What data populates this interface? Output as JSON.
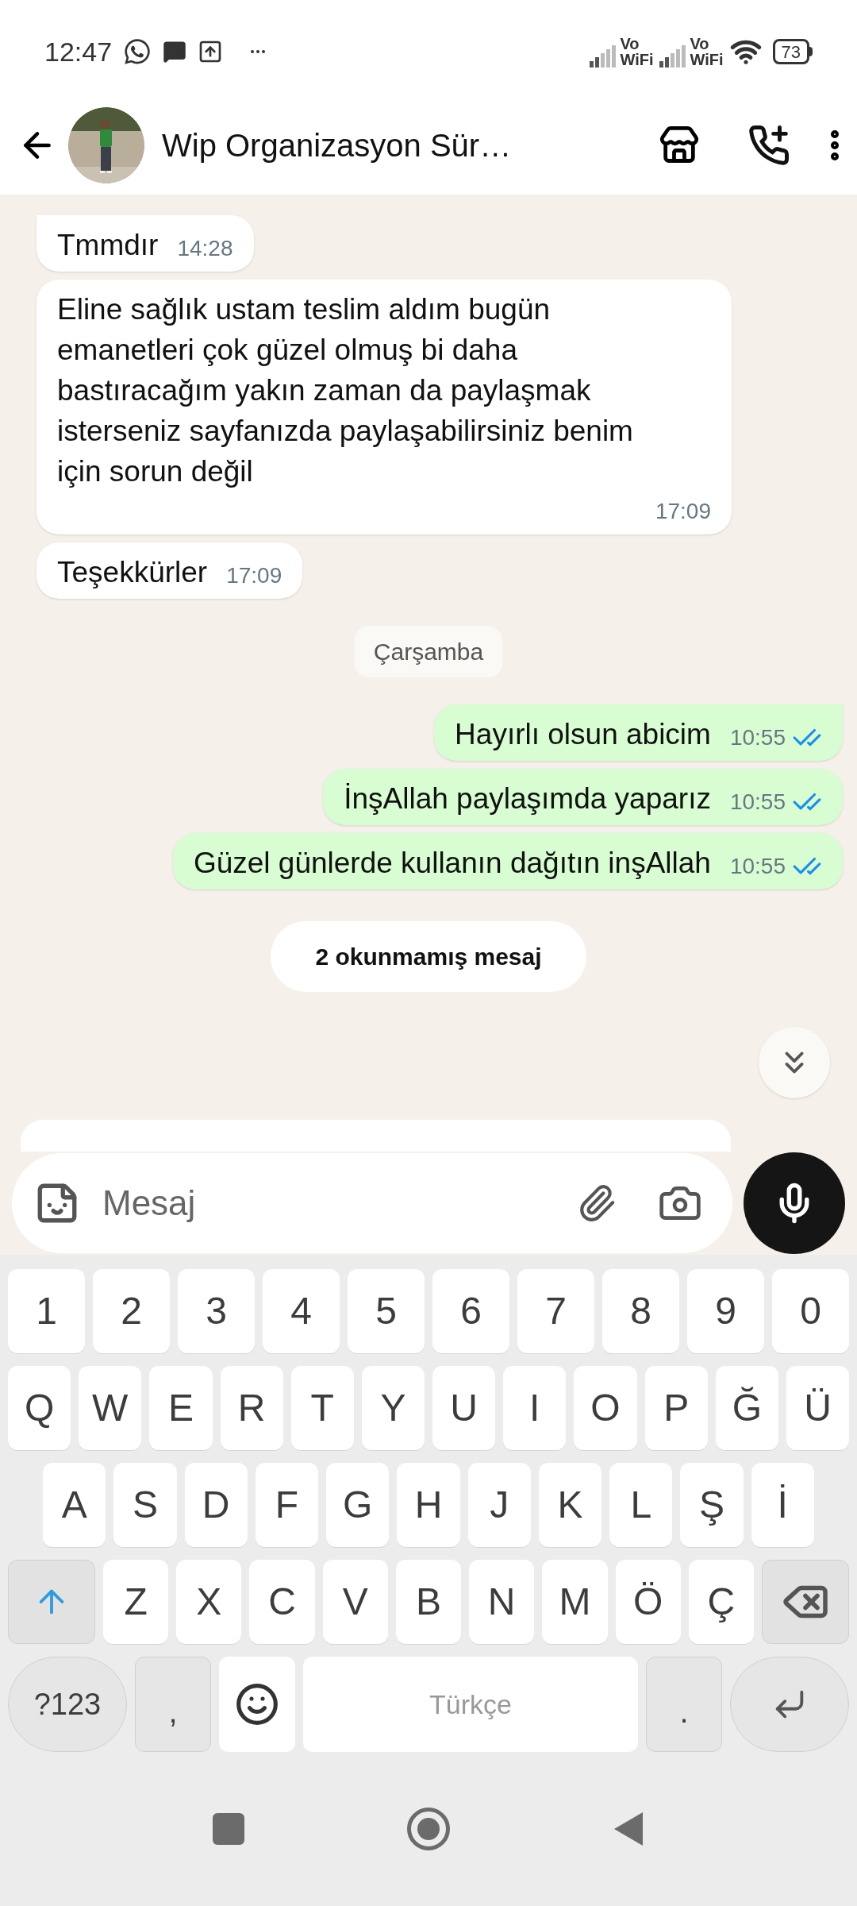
{
  "status_bar": {
    "time": "12:47",
    "sims": [
      {
        "label_top": "Vo",
        "label_bottom": "WiFi"
      },
      {
        "label_top": "Vo",
        "label_bottom": "WiFi"
      }
    ],
    "battery": "73"
  },
  "header": {
    "title": "Wip Organizasyon Sür…"
  },
  "chat": {
    "items": [
      {
        "kind": "incoming",
        "text": "Tmmdır",
        "time": "14:28",
        "tail": true
      },
      {
        "kind": "incoming",
        "text": "Eline sağlık ustam teslim aldım bugün emanetleri çok güzel olmuş bi daha bastıracağım yakın zaman da paylaşmak isterseniz sayfanızda paylaşabilirsiniz benim için sorun değil",
        "time": "17:09",
        "tail": false
      },
      {
        "kind": "incoming",
        "text": "Teşekkürler",
        "time": "17:09",
        "tail": false
      },
      {
        "kind": "date",
        "text": "Çarşamba"
      },
      {
        "kind": "outgoing",
        "text": "Hayırlı olsun abicim",
        "time": "10:55",
        "tail": true,
        "read": true
      },
      {
        "kind": "outgoing",
        "text": "İnşAllah paylaşımda yaparız",
        "time": "10:55",
        "tail": false,
        "read": true
      },
      {
        "kind": "outgoing",
        "text": "Güzel günlerde kullanın dağıtın inşAllah",
        "time": "10:55",
        "tail": false,
        "read": true
      },
      {
        "kind": "unread",
        "text": "2 okunmamış mesaj"
      }
    ]
  },
  "composer": {
    "placeholder": "Mesaj"
  },
  "keyboard": {
    "rows": [
      {
        "keys": [
          {
            "label": "1"
          },
          {
            "label": "2"
          },
          {
            "label": "3"
          },
          {
            "label": "4"
          },
          {
            "label": "5"
          },
          {
            "label": "6"
          },
          {
            "label": "7"
          },
          {
            "label": "8"
          },
          {
            "label": "9"
          },
          {
            "label": "0"
          }
        ]
      },
      {
        "keys": [
          {
            "label": "Q"
          },
          {
            "label": "W"
          },
          {
            "label": "E"
          },
          {
            "label": "R"
          },
          {
            "label": "T"
          },
          {
            "label": "Y"
          },
          {
            "label": "U"
          },
          {
            "label": "I"
          },
          {
            "label": "O"
          },
          {
            "label": "P"
          },
          {
            "label": "Ğ"
          },
          {
            "label": "Ü"
          }
        ]
      },
      {
        "keys": [
          {
            "label": "A"
          },
          {
            "label": "S"
          },
          {
            "label": "D"
          },
          {
            "label": "F"
          },
          {
            "label": "G"
          },
          {
            "label": "H"
          },
          {
            "label": "J"
          },
          {
            "label": "K"
          },
          {
            "label": "L"
          },
          {
            "label": "Ş"
          },
          {
            "label": "İ"
          }
        ]
      },
      {
        "keys": [
          {
            "kind": "shift",
            "on": true
          },
          {
            "label": "Z"
          },
          {
            "label": "X"
          },
          {
            "label": "C"
          },
          {
            "label": "V"
          },
          {
            "label": "B"
          },
          {
            "label": "N"
          },
          {
            "label": "M"
          },
          {
            "label": "Ö"
          },
          {
            "label": "Ç"
          },
          {
            "kind": "backspace"
          }
        ]
      },
      {
        "keys": [
          {
            "kind": "symbols",
            "label": "?123"
          },
          {
            "kind": "punct",
            "label": ","
          },
          {
            "kind": "emoji"
          },
          {
            "kind": "space",
            "label": "Türkçe"
          },
          {
            "kind": "punct",
            "label": "."
          },
          {
            "kind": "enter"
          }
        ]
      }
    ]
  }
}
